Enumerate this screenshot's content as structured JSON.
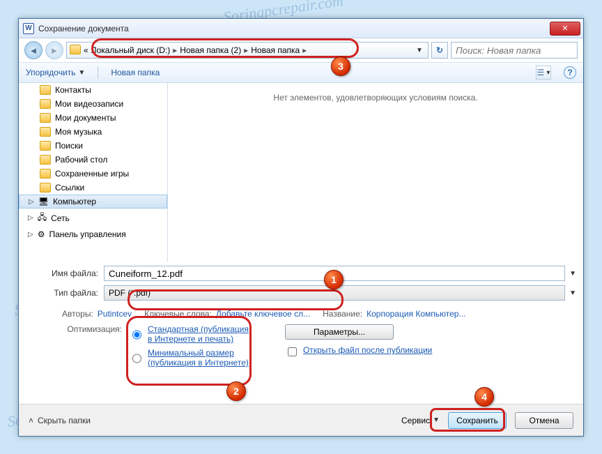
{
  "watermark": "Soringpcrepair.com",
  "window": {
    "title": "Сохранение документа"
  },
  "nav": {
    "pathPrefix": "«",
    "segments": [
      "Локальный диск (D:)",
      "Новая папка (2)",
      "Новая папка"
    ],
    "searchPlaceholder": "Поиск: Новая папка"
  },
  "toolbar": {
    "organize": "Упорядочить",
    "newFolder": "Новая папка"
  },
  "tree": {
    "items": [
      {
        "label": "Контакты"
      },
      {
        "label": "Мои видеозаписи"
      },
      {
        "label": "Мои документы"
      },
      {
        "label": "Моя музыка"
      },
      {
        "label": "Поиски"
      },
      {
        "label": "Рабочий стол"
      },
      {
        "label": "Сохраненные игры"
      },
      {
        "label": "Ссылки"
      },
      {
        "label": "Компьютер",
        "selected": true
      },
      {
        "label": "Сеть"
      },
      {
        "label": "Панель управления"
      }
    ]
  },
  "content": {
    "empty": "Нет элементов, удовлетворяющих условиям поиска."
  },
  "fields": {
    "filenameLabel": "Имя файла:",
    "filename": "Cuneiform_12.pdf",
    "filetypeLabel": "Тип файла:",
    "filetype": "PDF (*.pdf)"
  },
  "meta": {
    "authorsLabel": "Авторы:",
    "authors": "Putintcev",
    "keywordsLabel": "Ключевые слова:",
    "keywords": "Добавьте ключевое сл...",
    "titleLabel": "Название:",
    "title": "Корпорация Компьютер..."
  },
  "optimize": {
    "label": "Оптимизация:",
    "standard": "Стандартная (публикация в Интернете и печать)",
    "minimal": "Минимальный размер (публикация в Интернете)",
    "params": "Параметры...",
    "openAfter": "Открыть файл после публикации"
  },
  "bottom": {
    "hideFolders": "Скрыть папки",
    "tools": "Сервис",
    "save": "Сохранить",
    "cancel": "Отмена"
  },
  "badges": {
    "1": "1",
    "2": "2",
    "3": "3",
    "4": "4"
  }
}
